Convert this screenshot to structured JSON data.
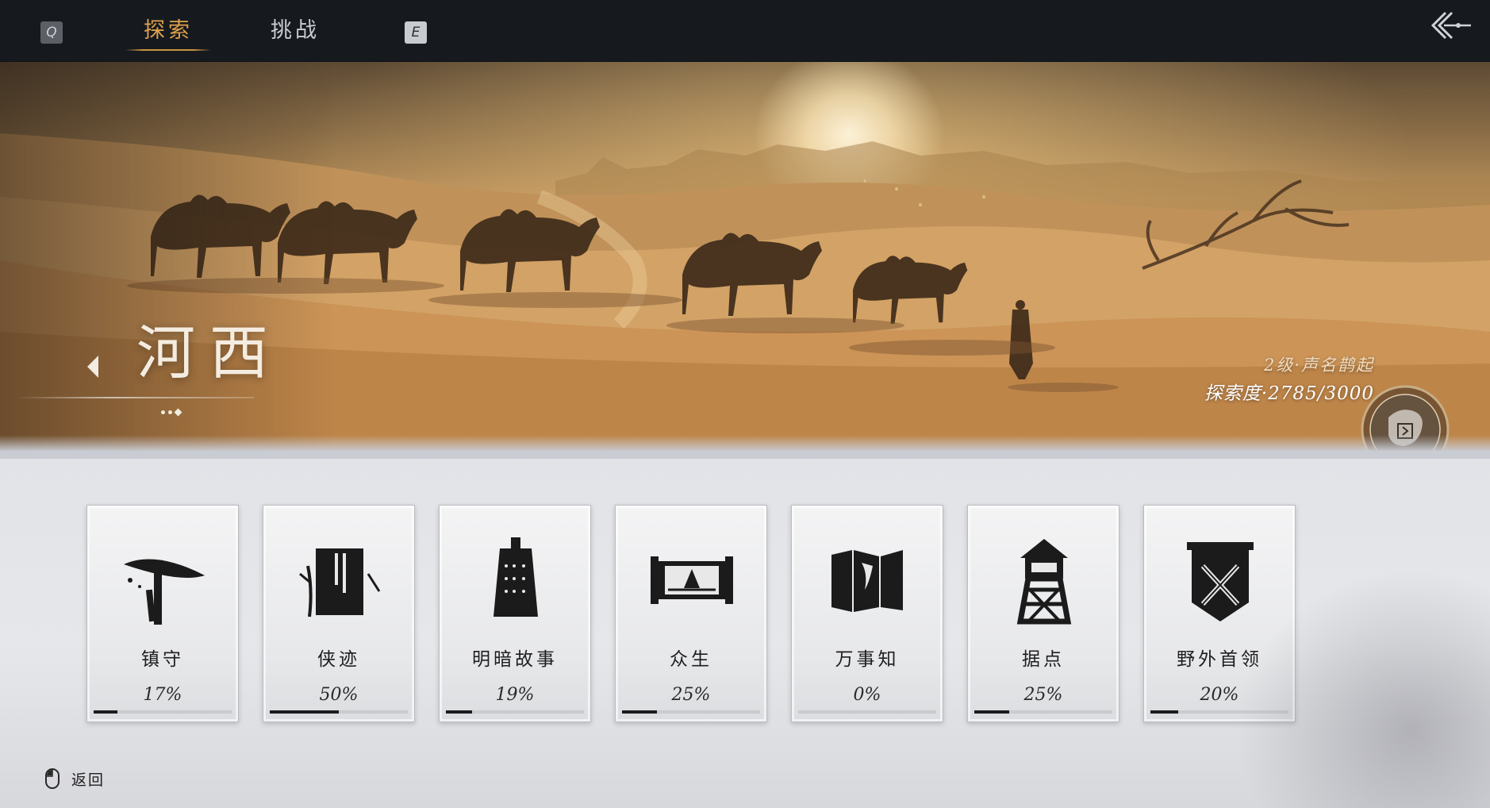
{
  "topbar": {
    "key_left": "Q",
    "key_right": "E",
    "tabs": [
      {
        "label": "探索",
        "active": true
      },
      {
        "label": "挑战",
        "active": false
      }
    ],
    "back_icon": "double-chevron-left-icon"
  },
  "banner": {
    "region_name": "河西",
    "fame_level": "2级·声名鹊起",
    "explore_progress": "探索度·2785/3000",
    "page_dots": 3
  },
  "categories": [
    {
      "label": "镇守",
      "percent_text": "17%",
      "progress": 17,
      "icon": "straw-hat-sword-icon"
    },
    {
      "label": "侠迹",
      "percent_text": "50%",
      "progress": 50,
      "icon": "book-bamboo-icon"
    },
    {
      "label": "明暗故事",
      "percent_text": "19%",
      "progress": 19,
      "icon": "bell-icon"
    },
    {
      "label": "众生",
      "percent_text": "25%",
      "progress": 25,
      "icon": "scroll-painting-icon"
    },
    {
      "label": "万事知",
      "percent_text": "0%",
      "progress": 0,
      "icon": "folding-screen-icon"
    },
    {
      "label": "据点",
      "percent_text": "25%",
      "progress": 25,
      "icon": "watchtower-icon"
    },
    {
      "label": "野外首领",
      "percent_text": "20%",
      "progress": 20,
      "icon": "crossed-swords-banner-icon"
    }
  ],
  "footer": {
    "back_label": "返回",
    "back_icon": "mouse-icon"
  },
  "colors": {
    "tab_active": "#e0a14c",
    "tab_inactive": "#c9ccd0",
    "topbar_bg": "#161a1f",
    "progress_fill": "#1c1c1c"
  }
}
